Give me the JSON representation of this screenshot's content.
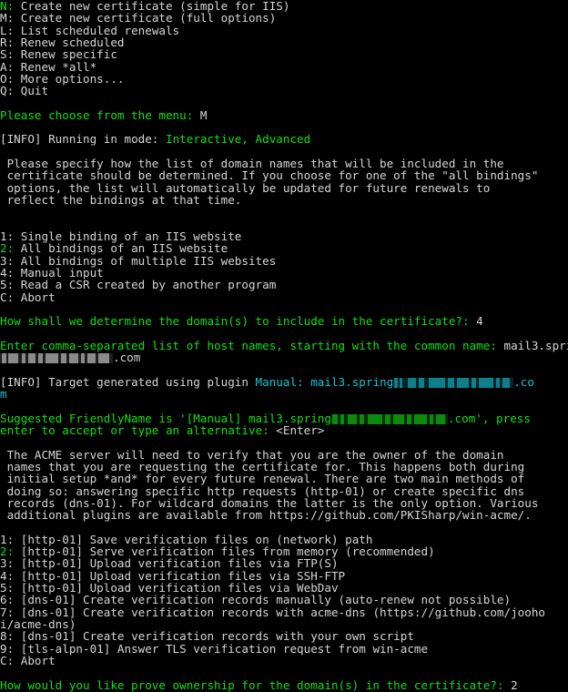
{
  "terminal": {
    "title": "win-acme",
    "colors": {
      "background": "#000000",
      "foreground": "#d6d6d6",
      "green": "#12e012",
      "cyan": "#13c5d6"
    }
  },
  "main_menu": {
    "items": [
      {
        "key": "N:",
        "key_color": "green",
        "label": " Create new certificate (simple for IIS)"
      },
      {
        "key": "M:",
        "key_color": "white",
        "label": " Create new certificate (full options)"
      },
      {
        "key": "L:",
        "key_color": "white",
        "label": " List scheduled renewals"
      },
      {
        "key": "R:",
        "key_color": "white",
        "label": " Renew scheduled"
      },
      {
        "key": "S:",
        "key_color": "white",
        "label": " Renew specific"
      },
      {
        "key": "A:",
        "key_color": "white",
        "label": " Renew *all*"
      },
      {
        "key": "O:",
        "key_color": "white",
        "label": " More options..."
      },
      {
        "key": "Q:",
        "key_color": "white",
        "label": " Quit"
      }
    ],
    "prompt": "Please choose from the menu: ",
    "answer": "M"
  },
  "info_mode": {
    "tag": "[INFO] ",
    "text": "Running in mode: ",
    "value": "Interactive, Advanced"
  },
  "target_explanation": [
    " Please specify how the list of domain names that will be included in the",
    " certificate should be determined. If you choose for one of the \"all bindings\"",
    " options, the list will automatically be updated for future renewals to",
    " reflect the bindings at that time."
  ],
  "target_menu": {
    "items": [
      {
        "key": "1:",
        "key_color": "white",
        "label": " Single binding of an IIS website"
      },
      {
        "key": "2:",
        "key_color": "green",
        "label": " All bindings of an IIS website"
      },
      {
        "key": "3:",
        "key_color": "white",
        "label": " All bindings of multiple IIS websites"
      },
      {
        "key": "4:",
        "key_color": "white",
        "label": " Manual input"
      },
      {
        "key": "5:",
        "key_color": "white",
        "label": " Read a CSR created by another program"
      },
      {
        "key": "C:",
        "key_color": "white",
        "label": " Abort"
      }
    ],
    "prompt": "How shall we determine the domain(s) to include in the certificate?: ",
    "answer": "4"
  },
  "host_names": {
    "prompt": "Enter comma-separated list of host names, starting with the common name: ",
    "answer_prefix": "mail3.spring",
    "answer_suffix": ".com",
    "redacted": true
  },
  "info_target": {
    "tag": "[INFO] ",
    "text": "Target generated using plugin ",
    "plugin": "Manual",
    "separator": ": ",
    "value_prefix": "mail3.spring",
    "value_suffix": ".co",
    "value_wrap": "m"
  },
  "friendly_name": {
    "line1_prefix": "Suggested FriendlyName is '[Manual] mail3.spring",
    "line1_suffix": ".com', press",
    "line2": "enter to accept or type an alternative: ",
    "answer": "<Enter>"
  },
  "validation_explanation": [
    " The ACME server will need to verify that you are the owner of the domain",
    " names that you are requesting the certificate for. This happens both during",
    " initial setup *and* for every future renewal. There are two main methods of",
    " doing so: answering specific http requests (http-01) or create specific dns",
    " records (dns-01). For wildcard domains the latter is the only option. Various",
    " additional plugins are available from https://github.com/PKISharp/win-acme/."
  ],
  "validation_menu": {
    "items": [
      {
        "key": "1:",
        "key_color": "white",
        "label": " [http-01] Save verification files on (network) path"
      },
      {
        "key": "2:",
        "key_color": "green",
        "label": " [http-01] Serve verification files from memory (recommended)"
      },
      {
        "key": "3:",
        "key_color": "white",
        "label": " [http-01] Upload verification files via FTP(S)"
      },
      {
        "key": "4:",
        "key_color": "white",
        "label": " [http-01] Upload verification files via SSH-FTP"
      },
      {
        "key": "5:",
        "key_color": "white",
        "label": " [http-01] Upload verification files via WebDav"
      },
      {
        "key": "6:",
        "key_color": "white",
        "label": " [dns-01] Create verification records manually (auto-renew not possible)"
      },
      {
        "key": "7:",
        "key_color": "white",
        "label": " [dns-01] Create verification records with acme-dns (https://github.com/jooho"
      },
      {
        "key": "",
        "key_color": "white",
        "label": "i/acme-dns)"
      },
      {
        "key": "8:",
        "key_color": "white",
        "label": " [dns-01] Create verification records with your own script"
      },
      {
        "key": "9:",
        "key_color": "white",
        "label": " [tls-alpn-01] Answer TLS verification request from win-acme"
      },
      {
        "key": "C:",
        "key_color": "white",
        "label": " Abort"
      }
    ],
    "prompt": "How would you like prove ownership for the domain(s) in the certificate?: ",
    "answer": "2"
  }
}
